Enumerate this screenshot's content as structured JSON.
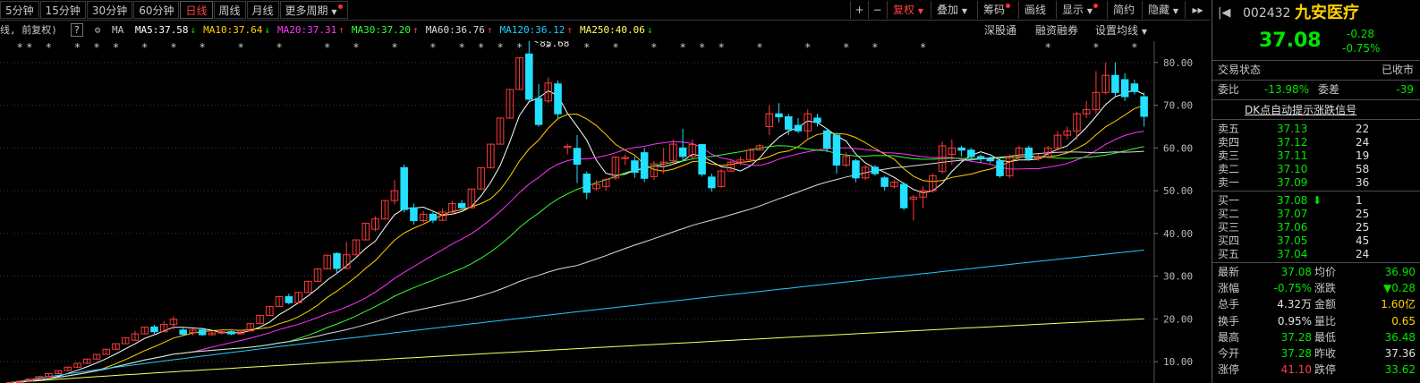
{
  "toolbar": {
    "periods": [
      "5分钟",
      "15分钟",
      "30分钟",
      "60分钟",
      "日线",
      "周线",
      "月线",
      "更多周期"
    ],
    "active_period": "日线",
    "plus": "+",
    "minus": "−",
    "fuquan": "复权",
    "diejia": "叠加",
    "chouma": "筹码",
    "huaxian": "画线",
    "xianshi": "显示",
    "jianyue": "简约",
    "yincang": "隐藏",
    "expand": "▸▸"
  },
  "ma_bar": {
    "prefix": "线, 前复权)",
    "help": "?",
    "gear": "⚙",
    "label": "MA",
    "items": [
      {
        "text": "MA5:37.58",
        "color": "#ffffff",
        "arrow": "↓",
        "arrow_color": "#00e600"
      },
      {
        "text": "MA10:37.64",
        "color": "#ffd200",
        "arrow": "↓",
        "arrow_color": "#00e600"
      },
      {
        "text": "MA20:37.31",
        "color": "#ff33ff",
        "arrow": "↑",
        "arrow_color": "#ff3030"
      },
      {
        "text": "MA30:37.20",
        "color": "#33ff33",
        "arrow": "↑",
        "arrow_color": "#ff3030"
      },
      {
        "text": "MA60:36.76",
        "color": "#dddddd",
        "arrow": "↑",
        "arrow_color": "#ff3030"
      },
      {
        "text": "MA120:36.12",
        "color": "#22ccff",
        "arrow": "↑",
        "arrow_color": "#ff3030"
      },
      {
        "text": "MA250:40.06",
        "color": "#ffff66",
        "arrow": "↓",
        "arrow_color": "#00e600"
      }
    ],
    "links": [
      "深股通",
      "融资融券",
      "设置均线"
    ]
  },
  "chart_data": {
    "type": "candlestick",
    "y_ticks": [
      "80.00",
      "70.00",
      "60.00",
      "50.00",
      "40.00",
      "30.00",
      "20.00",
      "10.00"
    ],
    "ylim": [
      5,
      85
    ],
    "max_label": "85.68",
    "grid": true,
    "candles": [
      [
        4.8,
        5.1,
        4.7,
        5.2
      ],
      [
        5.1,
        5.4,
        5.0,
        5.5
      ],
      [
        5.4,
        5.9,
        5.3,
        6.0
      ],
      [
        5.9,
        6.5,
        5.8,
        6.6
      ],
      [
        6.5,
        7.2,
        6.4,
        7.3
      ],
      [
        7.2,
        7.9,
        7.1,
        8.0
      ],
      [
        7.9,
        8.7,
        7.8,
        8.8
      ],
      [
        8.7,
        9.6,
        8.6,
        9.7
      ],
      [
        9.6,
        10.6,
        9.5,
        10.7
      ],
      [
        10.6,
        11.7,
        10.5,
        11.8
      ],
      [
        11.7,
        12.9,
        11.6,
        13.0
      ],
      [
        12.9,
        14.2,
        12.8,
        14.3
      ],
      [
        14.2,
        15.6,
        14.1,
        15.7
      ],
      [
        15.0,
        16.5,
        14.9,
        17.2
      ],
      [
        16.5,
        18.1,
        16.4,
        18.2
      ],
      [
        18.1,
        17.0,
        16.5,
        18.6
      ],
      [
        17.0,
        18.7,
        16.9,
        19.5
      ],
      [
        18.7,
        19.9,
        17.5,
        20.6
      ],
      [
        17.4,
        16.4,
        16.2,
        17.9
      ],
      [
        16.8,
        17.4,
        16.1,
        17.7
      ],
      [
        17.4,
        16.3,
        16.0,
        18.0
      ],
      [
        16.3,
        16.7,
        16.1,
        17.2
      ],
      [
        16.7,
        17.0,
        16.3,
        17.4
      ],
      [
        17.0,
        16.5,
        16.2,
        17.3
      ],
      [
        16.5,
        17.2,
        16.4,
        17.5
      ],
      [
        17.2,
        18.9,
        17.1,
        19.0
      ],
      [
        18.9,
        20.8,
        18.8,
        20.9
      ],
      [
        20.8,
        22.9,
        20.7,
        23.0
      ],
      [
        22.9,
        25.2,
        22.8,
        25.3
      ],
      [
        25.2,
        23.8,
        23.4,
        25.9
      ],
      [
        23.8,
        26.2,
        23.7,
        26.3
      ],
      [
        26.2,
        28.8,
        26.1,
        28.9
      ],
      [
        28.8,
        31.7,
        28.7,
        31.8
      ],
      [
        31.7,
        34.9,
        31.6,
        35.0
      ],
      [
        35.3,
        31.8,
        30.5,
        35.6
      ],
      [
        31.8,
        35.0,
        31.7,
        38.0
      ],
      [
        35.0,
        38.5,
        34.9,
        38.6
      ],
      [
        38.5,
        42.4,
        38.4,
        42.5
      ],
      [
        41.0,
        43.4,
        40.5,
        44.0
      ],
      [
        43.4,
        47.7,
        43.3,
        47.8
      ],
      [
        47.7,
        50.0,
        46.8,
        52.5
      ],
      [
        55.4,
        45.6,
        44.9,
        56.1
      ],
      [
        46.0,
        43.0,
        42.1,
        47.0
      ],
      [
        43.0,
        44.5,
        42.6,
        45.2
      ],
      [
        44.5,
        43.1,
        42.4,
        45.0
      ],
      [
        43.1,
        45.0,
        42.9,
        45.9
      ],
      [
        45.0,
        47.0,
        44.5,
        47.6
      ],
      [
        47.0,
        46.0,
        45.5,
        47.8
      ],
      [
        46.0,
        50.4,
        45.9,
        50.5
      ],
      [
        50.4,
        55.4,
        50.3,
        55.5
      ],
      [
        55.4,
        60.9,
        55.3,
        61.0
      ],
      [
        60.9,
        67.0,
        60.8,
        67.1
      ],
      [
        67.0,
        73.7,
        66.9,
        73.8
      ],
      [
        73.7,
        81.1,
        73.6,
        81.2
      ],
      [
        82.0,
        71.4,
        71.0,
        85.68
      ],
      [
        71.6,
        65.5,
        65.0,
        75.0
      ],
      [
        71.0,
        75.2,
        70.5,
        76.5
      ],
      [
        75.0,
        68.0,
        66.9,
        75.8
      ],
      [
        60.1,
        60.4,
        58.5,
        61.0
      ],
      [
        59.9,
        56.2,
        51.8,
        63.0
      ],
      [
        53.9,
        49.6,
        48.0,
        54.5
      ],
      [
        50.5,
        51.5,
        50.0,
        52.5
      ],
      [
        51.0,
        52.6,
        50.0,
        53.0
      ],
      [
        53.0,
        57.9,
        52.5,
        58.0
      ],
      [
        57.5,
        57.8,
        56.0,
        58.5
      ],
      [
        57.0,
        54.3,
        53.0,
        58.0
      ],
      [
        58.9,
        52.9,
        52.0,
        60.0
      ],
      [
        53.3,
        56.3,
        52.5,
        57.0
      ],
      [
        56.3,
        56.7,
        54.0,
        60.0
      ],
      [
        57.0,
        60.9,
        56.0,
        62.0
      ],
      [
        60.0,
        58.0,
        57.0,
        64.5
      ],
      [
        58.0,
        60.8,
        57.5,
        62.0
      ],
      [
        60.8,
        53.9,
        53.3,
        60.9
      ],
      [
        53.2,
        50.7,
        49.8,
        54.0
      ],
      [
        51.0,
        54.6,
        50.7,
        55.0
      ],
      [
        54.6,
        56.7,
        54.5,
        57.0
      ],
      [
        56.7,
        57.2,
        56.0,
        58.0
      ],
      [
        57.2,
        59.5,
        57.1,
        60.0
      ],
      [
        59.5,
        60.5,
        59.4,
        61.0
      ],
      [
        65.0,
        68.0,
        63.0,
        70.0
      ],
      [
        68.0,
        67.3,
        66.0,
        70.5
      ],
      [
        67.3,
        64.4,
        63.0,
        68.0
      ],
      [
        65.3,
        64.0,
        63.5,
        67.0
      ],
      [
        64.0,
        68.0,
        62.0,
        69.0
      ],
      [
        67.0,
        66.0,
        65.0,
        68.0
      ],
      [
        64.0,
        60.0,
        59.0,
        64.5
      ],
      [
        63.0,
        56.0,
        54.0,
        63.5
      ],
      [
        56.0,
        58.0,
        55.5,
        59.0
      ],
      [
        57.0,
        53.0,
        52.0,
        57.5
      ],
      [
        53.0,
        55.5,
        52.5,
        56.0
      ],
      [
        55.5,
        54.0,
        53.5,
        56.0
      ],
      [
        53.0,
        51.0,
        50.0,
        53.5
      ],
      [
        51.0,
        52.0,
        50.5,
        52.5
      ],
      [
        51.5,
        46.0,
        45.5,
        52.0
      ],
      [
        48.0,
        48.5,
        43.0,
        49.0
      ],
      [
        48.5,
        50.0,
        46.0,
        51.0
      ],
      [
        50.0,
        53.5,
        49.5,
        54.0
      ],
      [
        54.5,
        60.5,
        54.0,
        61.5
      ],
      [
        58.5,
        60.0,
        56.0,
        62.0
      ],
      [
        60.0,
        59.5,
        58.0,
        60.5
      ],
      [
        59.5,
        58.0,
        57.0,
        60.0
      ],
      [
        58.0,
        57.5,
        56.5,
        58.5
      ],
      [
        57.5,
        57.0,
        56.5,
        58.0
      ],
      [
        57.0,
        53.5,
        53.0,
        57.5
      ],
      [
        53.5,
        58.0,
        53.0,
        58.5
      ],
      [
        58.0,
        60.0,
        57.5,
        60.5
      ],
      [
        60.0,
        57.5,
        57.0,
        60.5
      ],
      [
        57.5,
        58.0,
        57.0,
        58.5
      ],
      [
        58.0,
        60.0,
        57.5,
        60.5
      ],
      [
        60.0,
        63.0,
        59.5,
        64.0
      ],
      [
        63.0,
        64.0,
        62.0,
        65.0
      ],
      [
        64.0,
        68.0,
        62.0,
        68.5
      ],
      [
        68.0,
        69.0,
        67.0,
        71.0
      ],
      [
        69.0,
        73.0,
        68.0,
        78.0
      ],
      [
        73.0,
        77.0,
        72.5,
        80.0
      ],
      [
        77.0,
        73.0,
        72.0,
        80.0
      ],
      [
        76.0,
        72.0,
        71.0,
        77.5
      ],
      [
        75.0,
        73.2,
        72.5,
        76.0
      ],
      [
        72.0,
        67.4,
        65.0,
        73.0
      ]
    ]
  },
  "quote": {
    "code": "002432",
    "name": "九安医疗",
    "price": "37.08",
    "change": "-0.28",
    "change_pct": "-0.75%",
    "status_label": "交易状态",
    "status_value": "已收市",
    "weibi_label": "委比",
    "weibi_value": "-13.98%",
    "weicha_label": "委差",
    "weicha_value": "-39",
    "dk_link": "DK点自动提示涨跌信号",
    "sell": [
      {
        "label": "卖五",
        "price": "37.13",
        "vol": "22"
      },
      {
        "label": "卖四",
        "price": "37.12",
        "vol": "24"
      },
      {
        "label": "卖三",
        "price": "37.11",
        "vol": "19"
      },
      {
        "label": "卖二",
        "price": "37.10",
        "vol": "58"
      },
      {
        "label": "卖一",
        "price": "37.09",
        "vol": "36"
      }
    ],
    "buy": [
      {
        "label": "买一",
        "price": "37.08",
        "arrow": "⬇",
        "vol": "1"
      },
      {
        "label": "买二",
        "price": "37.07",
        "arrow": "",
        "vol": "25"
      },
      {
        "label": "买三",
        "price": "37.06",
        "arrow": "",
        "vol": "25"
      },
      {
        "label": "买四",
        "price": "37.05",
        "arrow": "",
        "vol": "45"
      },
      {
        "label": "买五",
        "price": "37.04",
        "arrow": "",
        "vol": "24"
      }
    ],
    "stats": [
      {
        "l1": "最新",
        "v1": "37.08",
        "c1": "green",
        "l2": "均价",
        "v2": "36.90",
        "c2": "green"
      },
      {
        "l1": "涨幅",
        "v1": "-0.75%",
        "c1": "green",
        "l2": "涨跌",
        "v2": "▼0.28",
        "c2": "green"
      },
      {
        "l1": "总手",
        "v1": "4.32万",
        "c1": "white",
        "l2": "金额",
        "v2": "1.60亿",
        "c2": "yellow"
      },
      {
        "l1": "换手",
        "v1": "0.95%",
        "c1": "white",
        "l2": "量比",
        "v2": "0.65",
        "c2": "yellow"
      },
      {
        "l1": "最高",
        "v1": "37.28",
        "c1": "green",
        "l2": "最低",
        "v2": "36.48",
        "c2": "green"
      },
      {
        "l1": "今开",
        "v1": "37.28",
        "c1": "green",
        "l2": "昨收",
        "v2": "37.36",
        "c2": "white"
      },
      {
        "l1": "涨停",
        "v1": "41.10",
        "c1": "red",
        "l2": "跌停",
        "v2": "33.62",
        "c2": "green"
      }
    ]
  }
}
